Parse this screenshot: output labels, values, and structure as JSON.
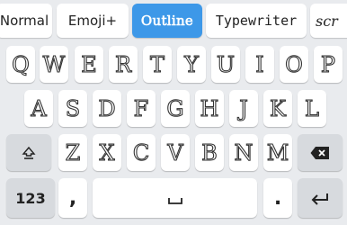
{
  "font_styles": [
    {
      "label": "Normal",
      "active": false
    },
    {
      "label": "Emoji+",
      "active": false
    },
    {
      "label": "Outline",
      "active": true
    },
    {
      "label": "Typewriter",
      "active": false
    },
    {
      "label": "scr",
      "active": false
    }
  ],
  "rows": {
    "row1": [
      "Q",
      "W",
      "E",
      "R",
      "T",
      "Y",
      "U",
      "I",
      "O",
      "P"
    ],
    "row2": [
      "A",
      "S",
      "D",
      "F",
      "G",
      "H",
      "J",
      "K",
      "L"
    ],
    "row3": [
      "Z",
      "X",
      "C",
      "V",
      "B",
      "N",
      "M"
    ]
  },
  "bottom": {
    "numbers_label": "123",
    "comma_label": ",",
    "period_label": "."
  },
  "icons": {
    "shift": "shift-icon",
    "backspace": "backspace-icon",
    "space": "space-icon",
    "enter": "enter-icon"
  },
  "colors": {
    "active_style": "#3d98e8",
    "background": "#e9ebee",
    "key": "#ffffff"
  }
}
